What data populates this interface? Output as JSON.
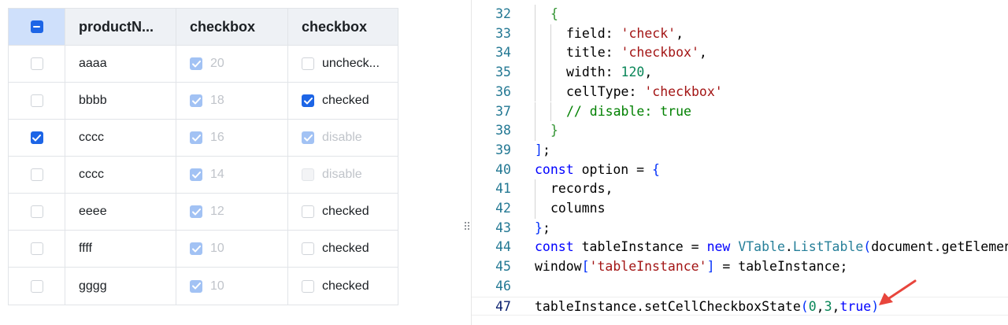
{
  "table": {
    "headers": [
      "productN...",
      "checkbox",
      "checkbox"
    ],
    "rows": [
      {
        "first_checked": false,
        "name": "aaaa",
        "c2_label": "20",
        "c3_label": "uncheck...",
        "c3_state": "unchecked"
      },
      {
        "first_checked": false,
        "name": "bbbb",
        "c2_label": "18",
        "c3_label": "checked",
        "c3_state": "checked"
      },
      {
        "first_checked": true,
        "name": "cccc",
        "c2_label": "16",
        "c3_label": "disable",
        "c3_state": "disabled-checked"
      },
      {
        "first_checked": false,
        "name": "cccc",
        "c2_label": "14",
        "c3_label": "disable",
        "c3_state": "disabled"
      },
      {
        "first_checked": false,
        "name": "eeee",
        "c2_label": "12",
        "c3_label": "checked",
        "c3_state": "unchecked"
      },
      {
        "first_checked": false,
        "name": "ffff",
        "c2_label": "10",
        "c3_label": "checked",
        "c3_state": "unchecked"
      },
      {
        "first_checked": false,
        "name": "gggg",
        "c2_label": "10",
        "c3_label": "checked",
        "c3_state": "unchecked"
      }
    ]
  },
  "editor": {
    "lines": [
      {
        "n": "32",
        "indent": 1,
        "tokens": [
          [
            "{",
            "b2"
          ]
        ]
      },
      {
        "n": "33",
        "indent": 2,
        "tokens": [
          [
            "field: ",
            ""
          ],
          [
            "'check'",
            "s"
          ],
          [
            ",",
            ""
          ]
        ]
      },
      {
        "n": "34",
        "indent": 2,
        "tokens": [
          [
            "title: ",
            ""
          ],
          [
            "'checkbox'",
            "s"
          ],
          [
            ",",
            ""
          ]
        ]
      },
      {
        "n": "35",
        "indent": 2,
        "tokens": [
          [
            "width: ",
            ""
          ],
          [
            "120",
            "n"
          ],
          [
            ",",
            ""
          ]
        ]
      },
      {
        "n": "36",
        "indent": 2,
        "tokens": [
          [
            "cellType: ",
            ""
          ],
          [
            "'checkbox'",
            "s"
          ]
        ]
      },
      {
        "n": "37",
        "indent": 2,
        "tokens": [
          [
            "// disable: true",
            "c"
          ]
        ]
      },
      {
        "n": "38",
        "indent": 1,
        "tokens": [
          [
            "}",
            "b2"
          ]
        ]
      },
      {
        "n": "39",
        "indent": 0,
        "tokens": [
          [
            "]",
            "b1"
          ],
          [
            ";",
            ""
          ]
        ]
      },
      {
        "n": "40",
        "indent": 0,
        "tokens": [
          [
            "const",
            "k"
          ],
          [
            " option = ",
            ""
          ],
          [
            "{",
            "b1"
          ]
        ]
      },
      {
        "n": "41",
        "indent": 1,
        "tokens": [
          [
            "records,",
            ""
          ]
        ]
      },
      {
        "n": "42",
        "indent": 1,
        "tokens": [
          [
            "columns",
            ""
          ]
        ]
      },
      {
        "n": "43",
        "indent": 0,
        "tokens": [
          [
            "}",
            "b1"
          ],
          [
            ";",
            ""
          ]
        ]
      },
      {
        "n": "44",
        "indent": 0,
        "tokens": [
          [
            "const",
            "k"
          ],
          [
            " tableInstance = ",
            ""
          ],
          [
            "new",
            "k"
          ],
          [
            " ",
            ""
          ],
          [
            "VTable",
            "t"
          ],
          [
            ".",
            ""
          ],
          [
            "ListTable",
            "t"
          ],
          [
            "(",
            "b1"
          ],
          [
            "document.getElemen",
            ""
          ]
        ]
      },
      {
        "n": "45",
        "indent": 0,
        "tokens": [
          [
            "window",
            ""
          ],
          [
            "[",
            "b1"
          ],
          [
            "'tableInstance'",
            "s"
          ],
          [
            "]",
            "b1"
          ],
          [
            " = tableInstance;",
            ""
          ]
        ]
      },
      {
        "n": "46",
        "indent": 0,
        "tokens": []
      },
      {
        "n": "47",
        "indent": 0,
        "tokens": [
          [
            "tableInstance.setCellCheckboxState",
            ""
          ],
          [
            "(",
            "b1"
          ],
          [
            "0",
            "n"
          ],
          [
            ",",
            ""
          ],
          [
            "3",
            "n"
          ],
          [
            ",",
            ""
          ],
          [
            "true",
            "k"
          ],
          [
            ")",
            "b1"
          ]
        ],
        "current": true
      }
    ]
  },
  "colors": {
    "accent": "#1d65e6",
    "arrow": "#e8453c"
  }
}
